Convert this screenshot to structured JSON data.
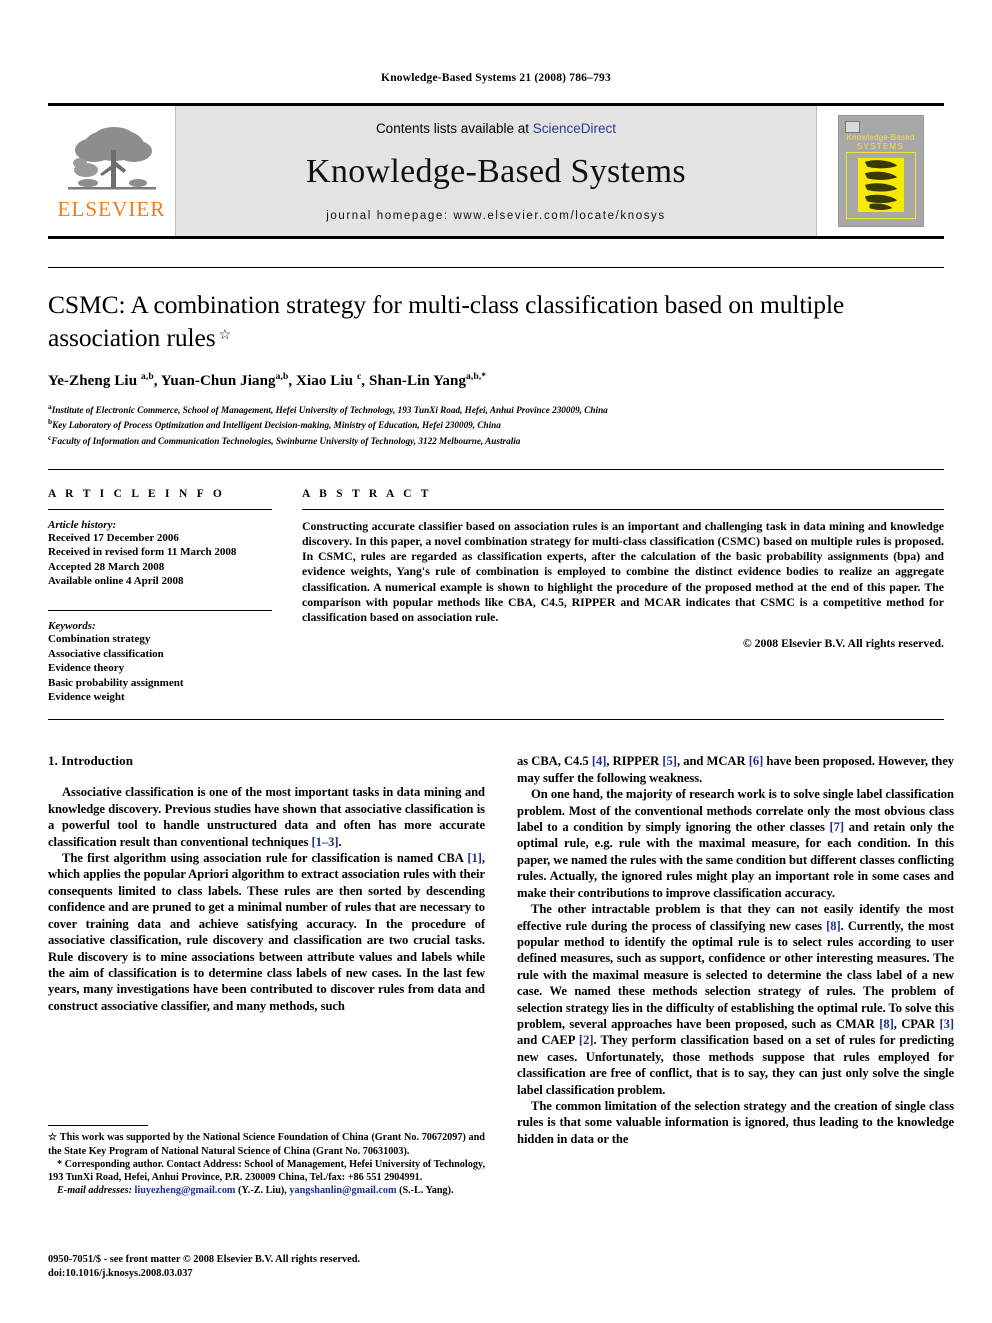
{
  "running_head": "Knowledge-Based Systems 21 (2008) 786–793",
  "masthead": {
    "contents_prefix": "Contents lists available at ",
    "sciencedirect": "ScienceDirect",
    "journal_title": "Knowledge-Based Systems",
    "homepage": "journal homepage: www.elsevier.com/locate/knosys",
    "publisher_wordmark": "ELSEVIER",
    "cover": {
      "line1": "Knowledge-Based",
      "line2": "SYSTEMS"
    },
    "link_color": "#2b3c91",
    "brand_color": "#ee7b1c",
    "band_color": "#e3e3e3"
  },
  "article": {
    "title": "CSMC: A combination strategy for multi-class classification based on multiple association rules",
    "title_footnote_mark": "☆",
    "authors_html": "Ye-Zheng Liu <sup>a,b</sup>, Yuan-Chun Jiang<sup>a,b</sup>, Xiao Liu <sup>c</sup>, Shan-Lin Yang<sup>a,b,</sup><sup>*</sup>",
    "affiliations": [
      "Institute of Electronic Commerce, School of Management, Hefei University of Technology, 193 TunXi Road, Hefei, Anhui Province 230009, China",
      "Key Laboratory of Process Optimization and Intelligent Decision-making, Ministry of Education, Hefei 230009, China",
      "Faculty of Information and Communication Technologies, Swinburne University of Technology, 3122 Melbourne, Australia"
    ],
    "affiliation_marks": [
      "a",
      "b",
      "c"
    ]
  },
  "article_info": {
    "heading": "A R T I C L E  I N F O",
    "history_label": "Article history:",
    "history": [
      "Received 17 December 2006",
      "Received in revised form 11 March 2008",
      "Accepted 28 March 2008",
      "Available online 4 April 2008"
    ],
    "keywords_label": "Keywords:",
    "keywords": [
      "Combination strategy",
      "Associative classification",
      "Evidence theory",
      "Basic probability assignment",
      "Evidence weight"
    ]
  },
  "abstract": {
    "heading": "A B S T R A C T",
    "text": "Constructing accurate classifier based on association rules is an important and challenging task in data mining and knowledge discovery. In this paper, a novel combination strategy for multi-class classification (CSMC) based on multiple rules is proposed. In CSMC, rules are regarded as classification experts, after the calculation of the basic probability assignments (bpa) and evidence weights, Yang's rule of combination is employed to combine the distinct evidence bodies to realize an aggregate classification. A numerical example is shown to highlight the procedure of the proposed method at the end of this paper. The comparison with popular methods like CBA, C4.5, RIPPER and MCAR indicates that CSMC is a competitive method for classification based on association rule.",
    "copyright": "© 2008 Elsevier B.V. All rights reserved."
  },
  "body": {
    "section_title": "1. Introduction",
    "left_paragraphs": [
      "Associative classification is one of the most important tasks in data mining and knowledge discovery. Previous studies have shown that associative classification is a powerful tool to handle unstructured data and often has more accurate classification result than conventional techniques [1–3].",
      "The first algorithm using association rule for classification is named CBA [1], which applies the popular Apriori algorithm to extract association rules with their consequents limited to class labels. These rules are then sorted by descending confidence and are pruned to get a minimal number of rules that are necessary to cover training data and achieve satisfying accuracy. In the procedure of associative classification, rule discovery and classification are two crucial tasks. Rule discovery is to mine associations between attribute values and labels while the aim of classification is to determine class labels of new cases. In the last few years, many investigations have been contributed to discover rules from data and construct associative classifier, and many methods, such"
    ],
    "right_paragraphs": [
      "as CBA, C4.5 [4], RIPPER [5], and MCAR [6] have been proposed. However, they may suffer the following weakness.",
      "On one hand, the majority of research work is to solve single label classification problem. Most of the conventional methods correlate only the most obvious class label to a condition by simply ignoring the other classes [7] and retain only the optimal rule, e.g. rule with the maximal measure, for each condition. In this paper, we named the rules with the same condition but different classes conflicting rules. Actually, the ignored rules might play an important role in some cases and make their contributions to improve classification accuracy.",
      "The other intractable problem is that they can not easily identify the most effective rule during the process of classifying new cases [8]. Currently, the most popular method to identify the optimal rule is to select rules according to user defined measures, such as support, confidence or other interesting measures. The rule with the maximal measure is selected to determine the class label of a new case. We named these methods selection strategy of rules. The problem of selection strategy lies in the difficulty of establishing the optimal rule. To solve this problem, several approaches have been proposed, such as CMAR [8], CPAR [3] and CAEP [2]. They perform classification based on a set of rules for predicting new cases. Unfortunately, those methods suppose that rules employed for classification are free of conflict, that is to say, they can just only solve the single label classification problem.",
      "The common limitation of the selection strategy and the creation of single class rules is that some valuable information is ignored, thus leading to the knowledge hidden in data or the"
    ],
    "reference_color": "#1c2f8c"
  },
  "footnotes": {
    "grant": "This work was supported by the National Science Foundation of China (Grant No. 70672097) and the State Key Program of National Natural Science of China (Grant No. 70631003).",
    "grant_mark": "☆",
    "corresponding": "Corresponding author. Contact Address: School of Management, Hefei University of Technology, 193 TunXi Road, Hefei, Anhui Province, P.R. 230009 China, Tel./fax: +86 551 2904991.",
    "corresponding_mark": "*",
    "email_label": "E-mail addresses:",
    "emails": [
      {
        "address": "liuyezheng@gmail.com",
        "owner": "(Y.-Z. Liu)"
      },
      {
        "address": "yangshanlin@gmail.com",
        "owner": "(S.-L. Yang)."
      }
    ]
  },
  "page_footer": {
    "issn_line": "0950-7051/$ - see front matter © 2008 Elsevier B.V. All rights reserved.",
    "doi_line": "doi:10.1016/j.knosys.2008.03.037"
  }
}
